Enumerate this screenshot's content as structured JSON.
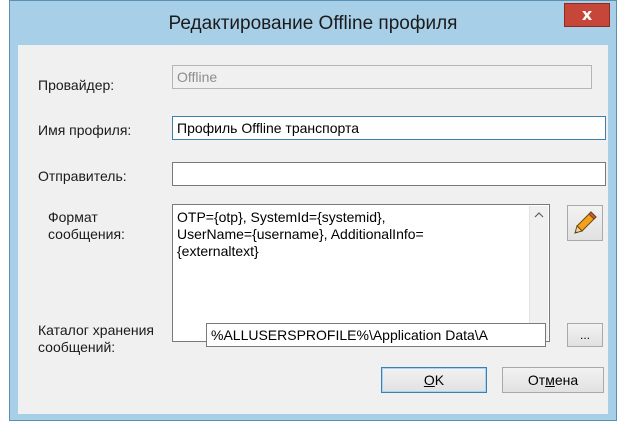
{
  "window": {
    "title": "Редактирование Offline профиля",
    "close_label": "x"
  },
  "form": {
    "provider_label": "Провайдер:",
    "provider_value": "Offline",
    "profile_name_label": "Имя профиля:",
    "profile_name_value": "Профиль Offline транспорта",
    "sender_label": "Отправитель:",
    "sender_value": "",
    "format_label_line1": "Формат",
    "format_label_line2": "сообщения:",
    "format_lines": [
      "OTP={otp}, SystemId={systemid},",
      "UserName={username}, AdditionalInfo=",
      "{externaltext}"
    ],
    "catalog_label_line1": "Каталог хранения",
    "catalog_label_line2": "сообщений:",
    "catalog_value": "%ALLUSERSPROFILE%\\Application Data\\A",
    "browse_label": "..."
  },
  "buttons": {
    "ok_accel": "O",
    "ok_rest": "K",
    "cancel_pre": "От",
    "cancel_accel": "м",
    "cancel_post": "ена"
  },
  "icons": {
    "edit_format": "pencil-icon",
    "scroll_up": "chevron-up-icon",
    "scroll_down": "chevron-down-icon",
    "close": "close-icon"
  }
}
